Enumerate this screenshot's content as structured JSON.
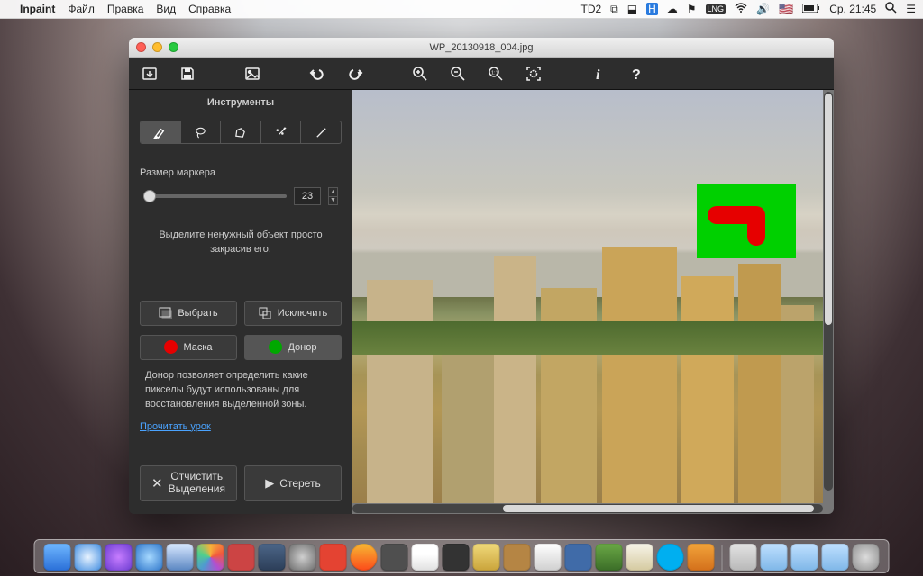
{
  "menubar": {
    "app": "Inpaint",
    "items": [
      "Файл",
      "Правка",
      "Вид",
      "Справка"
    ],
    "status": {
      "td": "2",
      "clock": "Ср, 21:45"
    }
  },
  "window": {
    "title": "WP_20130918_004.jpg"
  },
  "toolbar": {
    "icons": [
      "open",
      "save",
      "image",
      "undo",
      "redo",
      "zoom-in",
      "zoom-out",
      "zoom-100",
      "zoom-fit",
      "info",
      "help"
    ]
  },
  "side": {
    "tools_title": "Инструменты",
    "marker_label": "Размер маркера",
    "marker_value": "23",
    "hint1_line1": "Выделите ненужный объект просто",
    "hint1_line2": "закрасив его.",
    "select_label": "Выбрать",
    "exclude_label": "Исключить",
    "mask_label": "Маска",
    "donor_label": "Донор",
    "donor_help_l1": "Донор позволяет определить какие",
    "donor_help_l2": "пикселы будут использованы для",
    "donor_help_l3": "восстановления выделенной зоны.",
    "tutorial_link": "Прочитать урок",
    "clear_l1": "Отчистить",
    "clear_l2": "Выделения",
    "erase": "Стереть"
  },
  "colors": {
    "mask": "#e60000",
    "donor": "#00d000"
  }
}
